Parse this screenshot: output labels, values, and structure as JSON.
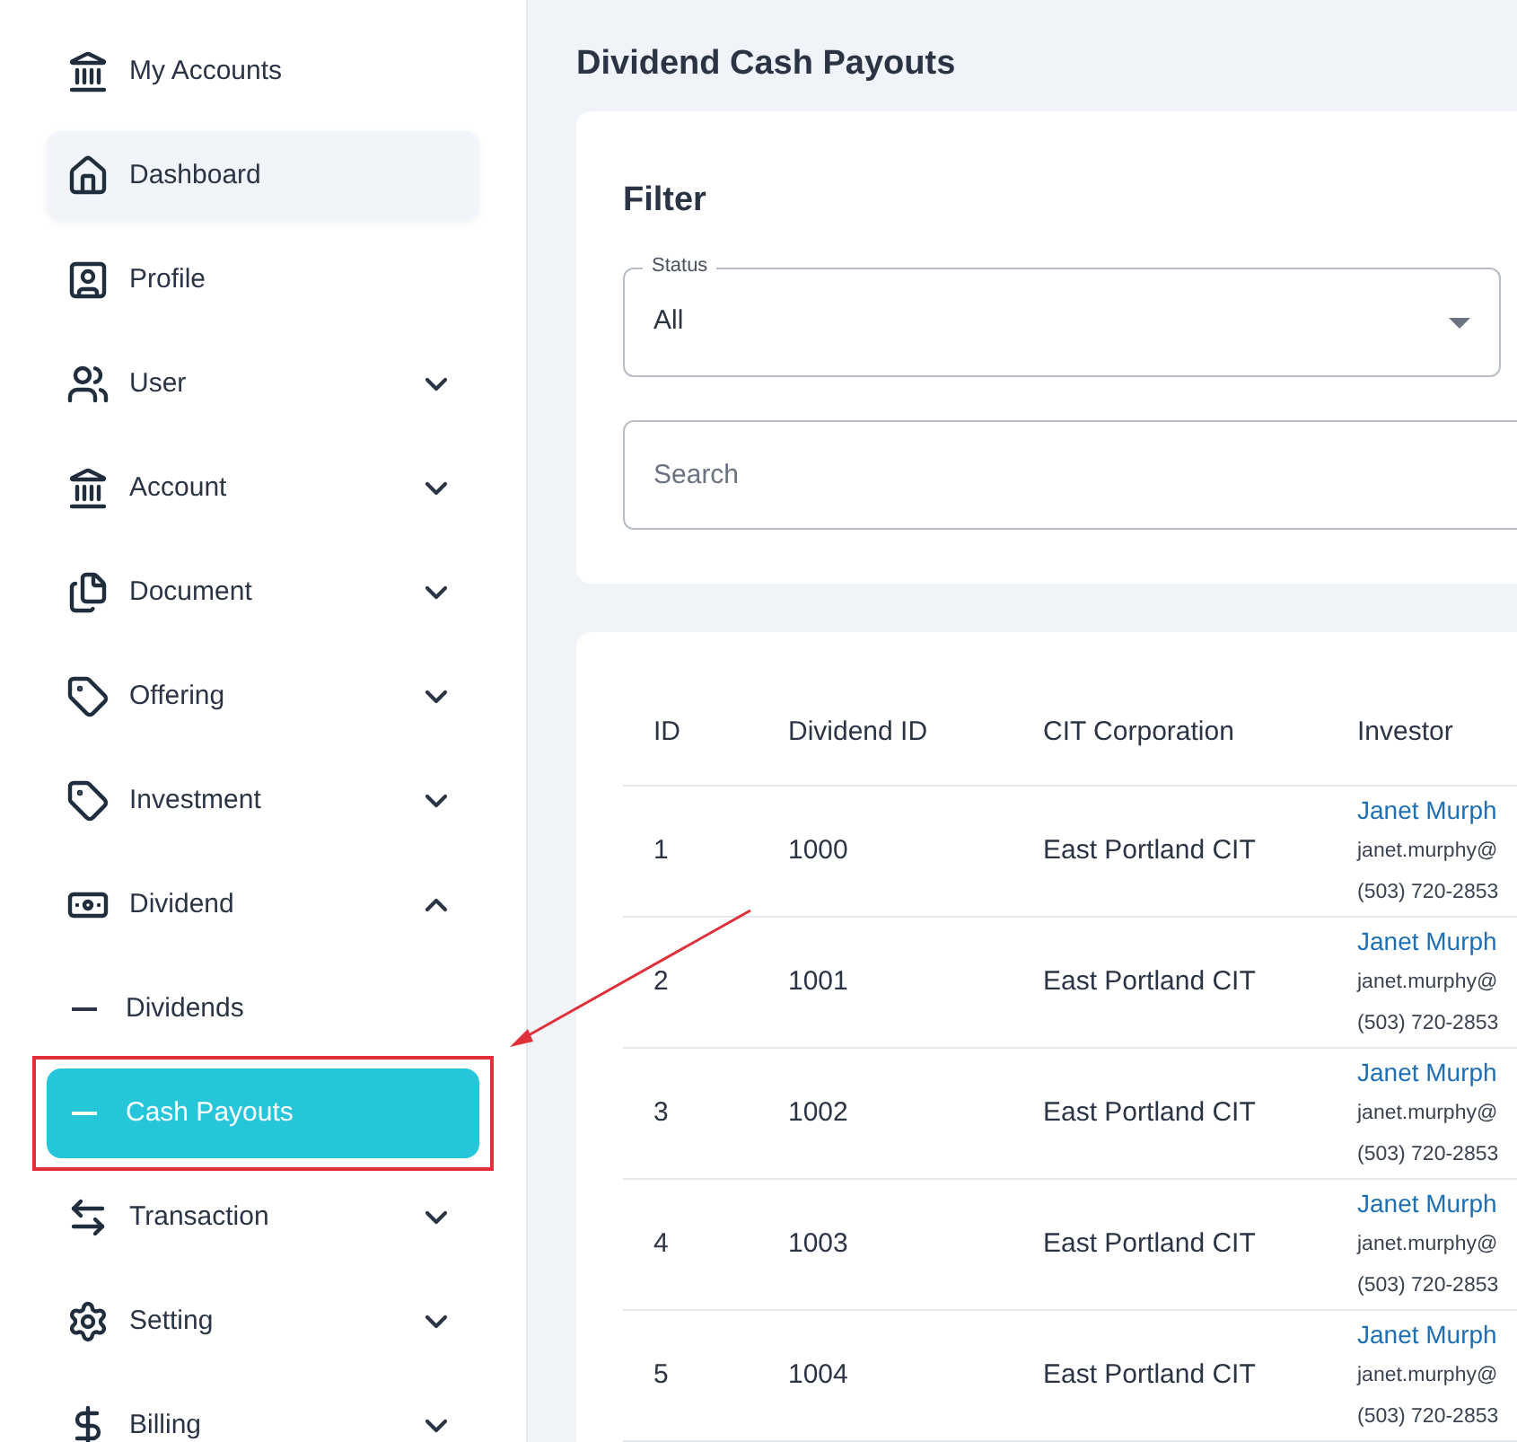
{
  "sidebar": {
    "items": [
      {
        "label": "My Accounts",
        "selected": false
      },
      {
        "label": "Dashboard",
        "selected": false,
        "hovered": true
      },
      {
        "label": "Profile",
        "selected": false
      },
      {
        "label": "User",
        "selected": false,
        "expanded": false
      },
      {
        "label": "Account",
        "selected": false,
        "expanded": false
      },
      {
        "label": "Document",
        "selected": false,
        "expanded": false
      },
      {
        "label": "Offering",
        "selected": false,
        "expanded": false
      },
      {
        "label": "Investment",
        "selected": false,
        "expanded": false
      },
      {
        "label": "Dividend",
        "selected": false,
        "expanded": true,
        "children": [
          {
            "label": "Dividends",
            "selected": false,
            "annotated": false
          },
          {
            "label": "Cash Payouts",
            "selected": true,
            "annotated": true
          }
        ]
      },
      {
        "label": "Transaction",
        "selected": false,
        "expanded": false
      },
      {
        "label": "Setting",
        "selected": false,
        "expanded": false
      },
      {
        "label": "Billing",
        "selected": false,
        "expanded": false
      }
    ]
  },
  "page_title": "Dividend Cash Payouts",
  "filter": {
    "title": "Filter",
    "status": {
      "label": "Status",
      "value": "All"
    },
    "search": {
      "placeholder": "Search"
    }
  },
  "table": {
    "columns": [
      "ID",
      "Dividend ID",
      "CIT Corporation",
      "Investor"
    ],
    "rows": [
      {
        "id": "1",
        "dividend_id": "1000",
        "corporation": "East Portland CIT",
        "investor": {
          "name": "Janet Murph",
          "email": "janet.murphy@",
          "phone": "(503) 720-2853"
        }
      },
      {
        "id": "2",
        "dividend_id": "1001",
        "corporation": "East Portland CIT",
        "investor": {
          "name": "Janet Murph",
          "email": "janet.murphy@",
          "phone": "(503) 720-2853"
        }
      },
      {
        "id": "3",
        "dividend_id": "1002",
        "corporation": "East Portland CIT",
        "investor": {
          "name": "Janet Murph",
          "email": "janet.murphy@",
          "phone": "(503) 720-2853"
        }
      },
      {
        "id": "4",
        "dividend_id": "1003",
        "corporation": "East Portland CIT",
        "investor": {
          "name": "Janet Murph",
          "email": "janet.murphy@",
          "phone": "(503) 720-2853"
        }
      },
      {
        "id": "5",
        "dividend_id": "1004",
        "corporation": "East Portland CIT",
        "investor": {
          "name": "Janet Murph",
          "email": "janet.murphy@",
          "phone": "(503) 720-2853"
        }
      }
    ]
  }
}
